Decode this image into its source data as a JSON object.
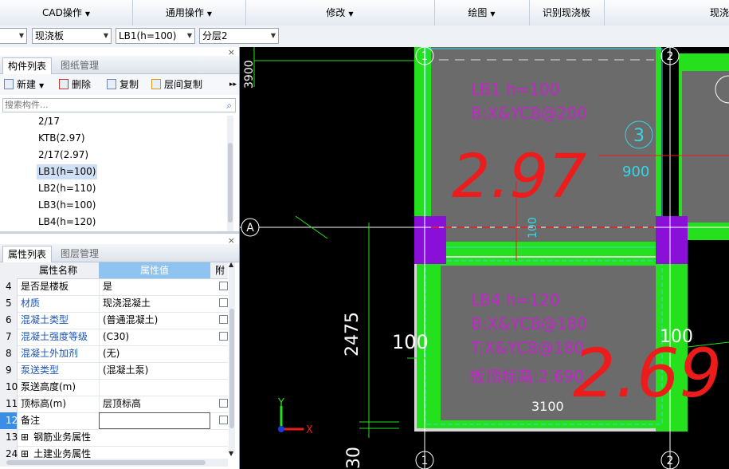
{
  "ribbon": {
    "cad": "CAD操作",
    "general": "通用操作",
    "modify": "修改",
    "draw": "绘图",
    "identify": "识别现浇板",
    "cut": "现浇"
  },
  "selectors": {
    "type": "现浇板",
    "component": "LB1(h=100)",
    "layer": "分层2"
  },
  "component_panel": {
    "tab_active": "构件列表",
    "tab_inactive": "图纸管理",
    "close": "×",
    "btn_new": "新建",
    "btn_delete": "删除",
    "btn_copy": "复制",
    "btn_floor_copy": "层间复制",
    "search_placeholder": "搜索构件...",
    "items": [
      "2/17",
      "KTB(2.97)",
      "2/17(2.97)",
      "LB1(h=100)",
      "LB2(h=110)",
      "LB3(h=100)",
      "LB4(h=120)"
    ]
  },
  "property_panel": {
    "tab_active": "属性列表",
    "tab_inactive": "图层管理",
    "close": "×",
    "col_name": "属性名称",
    "col_value": "属性值",
    "col_attach": "附",
    "rows": [
      {
        "num": "4",
        "name": "是否是楼板",
        "value": "是",
        "check": true
      },
      {
        "num": "5",
        "name": "材质",
        "value": "现浇混凝土",
        "check": true
      },
      {
        "num": "6",
        "name": "混凝土类型",
        "value": "(普通混凝土)",
        "check": true
      },
      {
        "num": "7",
        "name": "混凝土强度等级",
        "value": "(C30)",
        "check": true
      },
      {
        "num": "8",
        "name": "混凝土外加剂",
        "value": "(无)",
        "check": false
      },
      {
        "num": "9",
        "name": "泵送类型",
        "value": "(混凝土泵)",
        "check": false
      },
      {
        "num": "10",
        "name": "泵送高度(m)",
        "value": "",
        "check": false
      },
      {
        "num": "11",
        "name": "顶标高(m)",
        "value": "层顶标高",
        "check": true
      },
      {
        "num": "12",
        "name": "备注",
        "value": "",
        "check": true
      },
      {
        "num": "13",
        "name": "钢筋业务属性",
        "value": "",
        "check": false
      },
      {
        "num": "24",
        "name": "土建业务属性",
        "value": "",
        "check": false
      }
    ]
  },
  "canvas": {
    "axis_1": "1",
    "axis_2": "2",
    "axis_3": "3",
    "axis_a": "A",
    "dim_3900": "3900",
    "dim_900": "900",
    "dim_100_v": "100",
    "dim_2475": "2475",
    "dim_100_h": "100",
    "dim_100_r": "100",
    "dim_3100": "3100",
    "dim_bottom": "30",
    "slab1_line1": "LB1 h=100",
    "slab1_line2": "B:X&YC8@200",
    "slab4_line1": "LB4 h=120",
    "slab4_line2": "B:X&YC8@180",
    "slab4_line3": "T:X&YC8@180",
    "slab4_line4": "板顶标高:2.690",
    "handwritten_1": "2.97",
    "handwritten_2": "2.69",
    "ucs_y": "Y",
    "ucs_x": "X"
  },
  "colors": {
    "wall_green": "#25e01c",
    "slab_gray": "#6b6b6b",
    "column_purple": "#8a10d8",
    "annotation_magenta": "#c227c9",
    "handwriting_red": "#ec1c1c",
    "selection_blue": "#cfe0f5",
    "header_blue": "#8fc3f0"
  }
}
